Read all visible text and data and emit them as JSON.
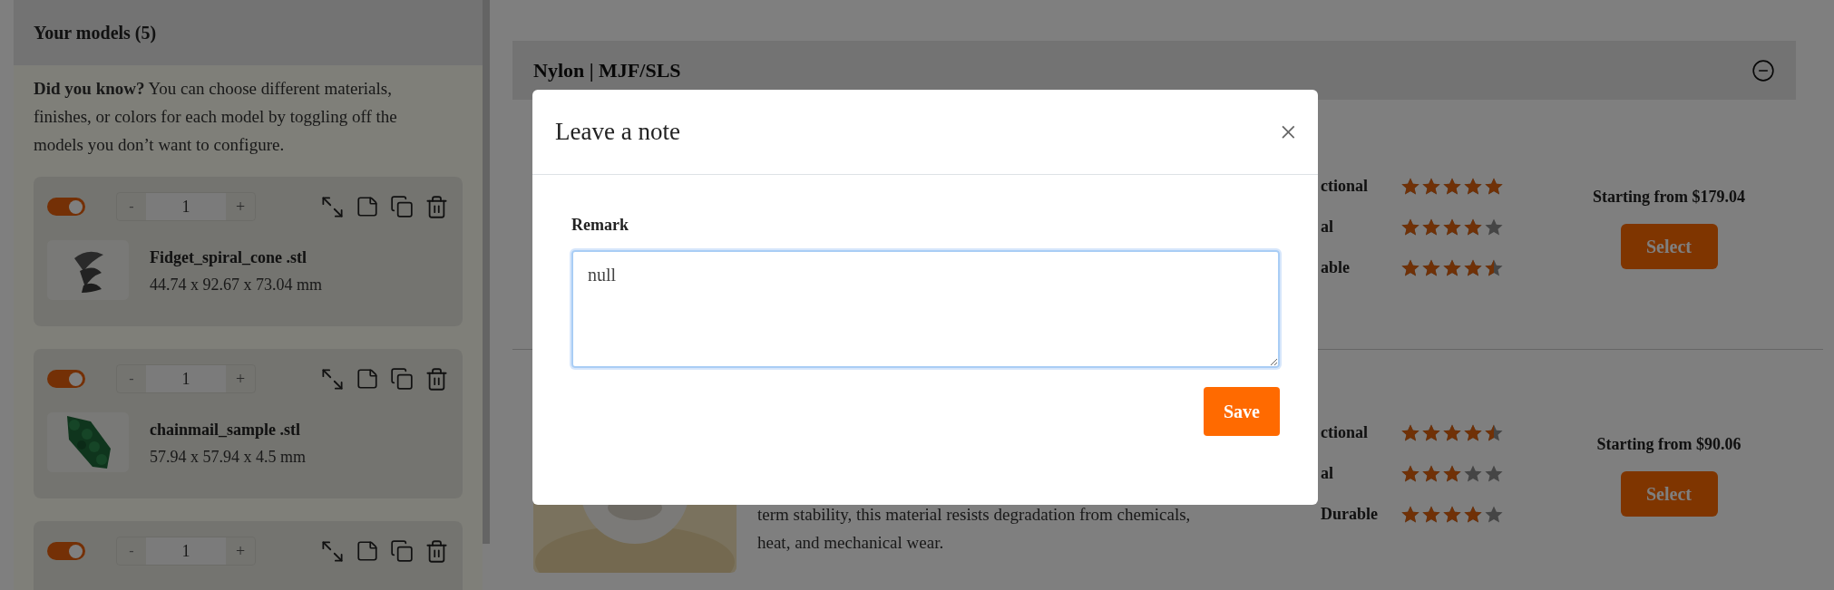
{
  "sidebar": {
    "title": "Your models (5)",
    "tip": "**Did you know?** You can choose different materials, finishes, or colors for each model by toggling off the models you don’t want to configure.",
    "models": [
      {
        "enabled": true,
        "quantity": "1",
        "name": "Fidget_spiral_cone .stl",
        "dimensions": "44.74 x 92.67 x 73.04 mm"
      },
      {
        "enabled": true,
        "quantity": "1",
        "name": "chainmail_sample .stl",
        "dimensions": "57.94 x 57.94 x 4.5 mm"
      },
      {
        "enabled": true,
        "quantity": "1"
      }
    ],
    "quantity_minus": "-",
    "quantity_plus": "+"
  },
  "material_group": {
    "title": "Nylon | MJF/SLS",
    "expanded": true,
    "materials": [
      {
        "ratings": [
          {
            "label": "ctional",
            "stars": 5
          },
          {
            "label": "al",
            "stars": 4
          },
          {
            "label": "able",
            "stars": 4.5
          }
        ],
        "price": "Starting from $179.04",
        "button": "Select"
      },
      {
        "description": "term stability, this material resists degradation from chemicals, heat, and mechanical wear.",
        "ratings": [
          {
            "label": "ctional",
            "stars": 4.5
          },
          {
            "label": "al",
            "stars": 3
          },
          {
            "label": "Durable",
            "stars": 4
          }
        ],
        "price": "Starting from $90.06",
        "button": "Select"
      }
    ]
  },
  "modal": {
    "title": "Leave a note",
    "close": "×",
    "field_label": "Remark",
    "value": "null",
    "button": "Save"
  }
}
